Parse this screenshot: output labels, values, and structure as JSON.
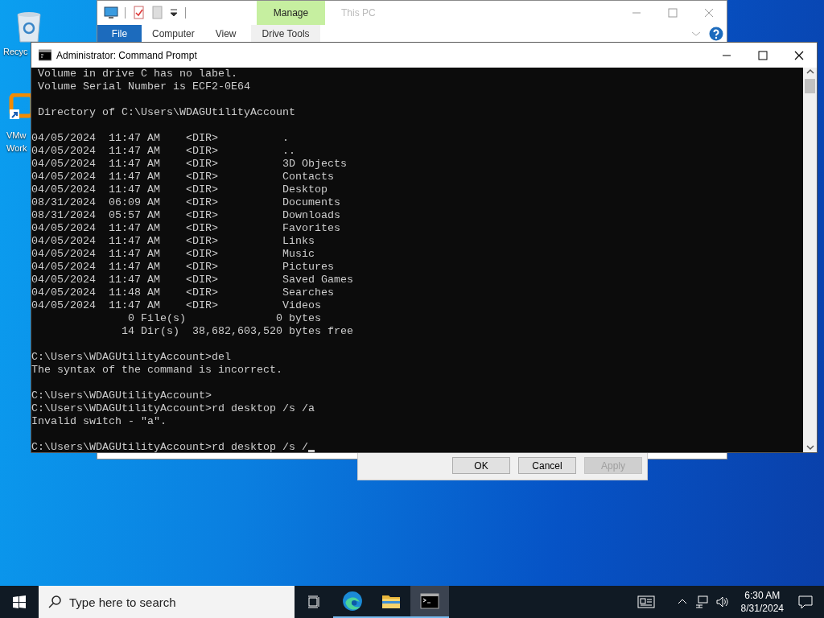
{
  "desktop_icons": [
    {
      "kind": "recycle-bin",
      "lines": [
        "Recyc"
      ]
    },
    {
      "kind": "vmware",
      "lines": [
        "VMw",
        "Work"
      ]
    }
  ],
  "explorer_window": {
    "title": "This PC",
    "context_group": "Manage",
    "ribbon_tabs": [
      {
        "label": "File",
        "kind": "file"
      },
      {
        "label": "Computer",
        "kind": "plain"
      },
      {
        "label": "View",
        "kind": "plain"
      },
      {
        "label": "Drive Tools",
        "kind": "contextual"
      }
    ]
  },
  "dialog": {
    "buttons": [
      {
        "label": "OK",
        "disabled": false
      },
      {
        "label": "Cancel",
        "disabled": false
      },
      {
        "label": "Apply",
        "disabled": true
      }
    ]
  },
  "console_window": {
    "title": "Administrator: Command Prompt",
    "blocks": [
      [
        " Volume in drive C has no label.",
        " Volume Serial Number is ECF2-0E64"
      ],
      [
        " Directory of C:\\Users\\WDAGUtilityAccount"
      ],
      [
        "04/05/2024  11:47 AM    <DIR>          .",
        "04/05/2024  11:47 AM    <DIR>          ..",
        "04/05/2024  11:47 AM    <DIR>          3D Objects",
        "04/05/2024  11:47 AM    <DIR>          Contacts",
        "04/05/2024  11:47 AM    <DIR>          Desktop",
        "08/31/2024  06:09 AM    <DIR>          Documents",
        "08/31/2024  05:57 AM    <DIR>          Downloads",
        "04/05/2024  11:47 AM    <DIR>          Favorites",
        "04/05/2024  11:47 AM    <DIR>          Links",
        "04/05/2024  11:47 AM    <DIR>          Music",
        "04/05/2024  11:47 AM    <DIR>          Pictures",
        "04/05/2024  11:47 AM    <DIR>          Saved Games",
        "04/05/2024  11:48 AM    <DIR>          Searches",
        "04/05/2024  11:47 AM    <DIR>          Videos",
        "               0 File(s)              0 bytes",
        "              14 Dir(s)  38,682,603,520 bytes free"
      ],
      [
        "C:\\Users\\WDAGUtilityAccount>del",
        "The syntax of the command is incorrect."
      ],
      [
        "C:\\Users\\WDAGUtilityAccount>",
        "C:\\Users\\WDAGUtilityAccount>rd desktop /s /a",
        "Invalid switch - \"a\"."
      ],
      [
        "C:\\Users\\WDAGUtilityAccount>rd desktop /s /"
      ]
    ]
  },
  "taskbar": {
    "search": {
      "placeholder": "Type here to search"
    },
    "apps": [
      {
        "kind": "edge",
        "selected": false
      },
      {
        "kind": "explorer",
        "selected": false
      },
      {
        "kind": "console",
        "selected": true
      }
    ],
    "clock": {
      "time": "6:30 AM",
      "date": "8/31/2024"
    }
  }
}
